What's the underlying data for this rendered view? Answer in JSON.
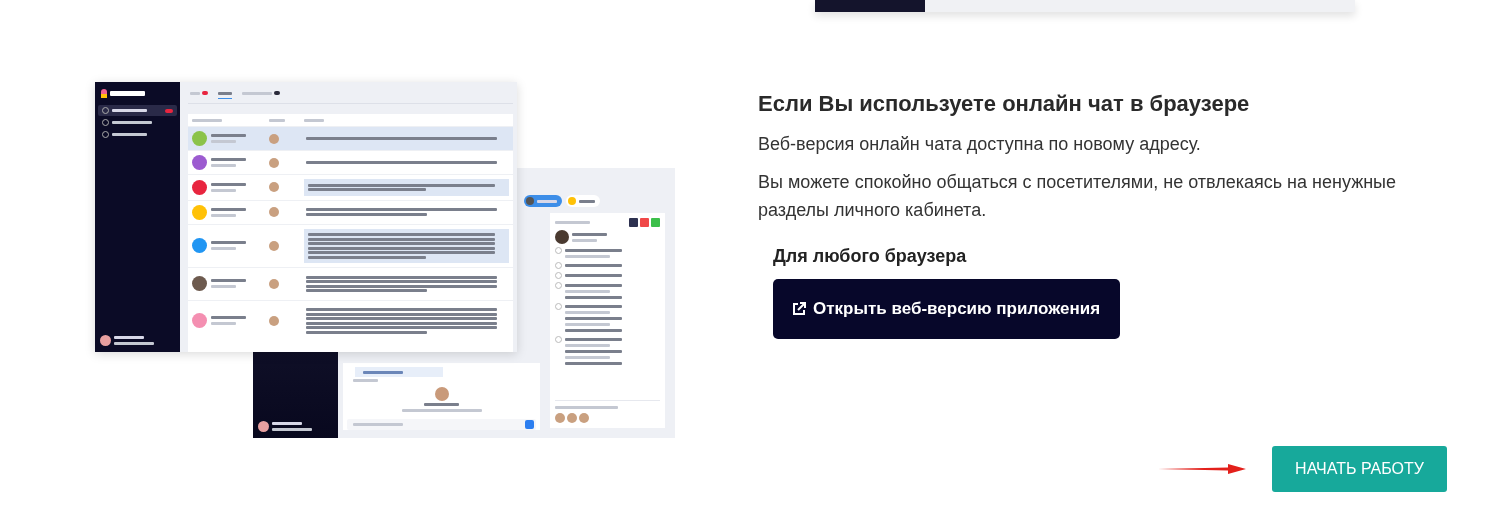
{
  "heading": "Если Вы используете онлайн чат в браузере",
  "paragraphs": [
    "Веб-версия онлайн чата доступна по новому адресу.",
    "Вы можете спокойно общаться с посетителями, не отвлекаясь на ненужные разделы личного кабинета."
  ],
  "subheading": "Для любого браузера",
  "open_button": "Открыть веб-версию приложения",
  "start_button": "НАЧАТЬ РАБОТУ"
}
